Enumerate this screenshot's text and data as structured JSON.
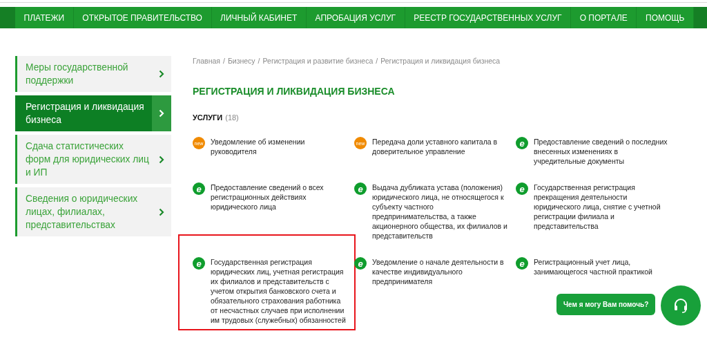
{
  "nav": [
    {
      "label": "ПЛАТЕЖИ"
    },
    {
      "label": "ОТКРЫТОЕ ПРАВИТЕЛЬСТВО"
    },
    {
      "label": "ЛИЧНЫЙ КАБИНЕТ"
    },
    {
      "label": "АПРОБАЦИЯ УСЛУГ"
    },
    {
      "label": "РЕЕСТР ГОСУДАРСТВЕННЫХ УСЛУГ"
    },
    {
      "label": "О ПОРТАЛЕ"
    },
    {
      "label": "ПОМОЩЬ"
    }
  ],
  "sidebar": {
    "items": [
      {
        "label": "Меры государственной поддержки",
        "selected": false
      },
      {
        "label": "Регистрация и ликвидация бизнеса",
        "selected": true
      },
      {
        "label": "Сдача статистических форм для юридических лиц и ИП",
        "selected": false
      },
      {
        "label": "Сведения о юридических лицах, филиалах, представительствах",
        "selected": false
      }
    ]
  },
  "breadcrumbs": [
    {
      "label": "Главная"
    },
    {
      "separator": "/",
      "label": "Бизнесу"
    },
    {
      "separator": "/",
      "label": "Регистрация и развитие бизнеса"
    },
    {
      "separator": "/",
      "label": "Регистрация и ликвидация бизнеса"
    }
  ],
  "title": "РЕГИСТРАЦИЯ И ЛИКВИДАЦИЯ БИЗНЕСА",
  "services": {
    "heading": "УСЛУГИ",
    "count": "(18)",
    "items": [
      {
        "kind": "new",
        "badge": "new",
        "text": "Уведомление об изменении руководителя",
        "highlighted": false
      },
      {
        "kind": "new",
        "badge": "new",
        "text": "Передача доли уставного капитала в доверительное управление",
        "highlighted": false
      },
      {
        "kind": "electronic",
        "badge": "e",
        "text": "Предоставление сведений о последних внесенных изменениях в учредительные документы",
        "highlighted": false
      },
      {
        "kind": "electronic",
        "badge": "e",
        "text": "Предоставление сведений о всех регистрационных действиях юридического лица",
        "highlighted": false
      },
      {
        "kind": "electronic",
        "badge": "e",
        "text": "Выдача дубликата устава (положения) юридического лица, не относящегося к субъекту частного предпринимательства, а также акционерного общества, их филиалов и представительств",
        "highlighted": false
      },
      {
        "kind": "electronic",
        "badge": "e",
        "text": "Государственная регистрация прекращения деятельности юридического лица, снятие с учетной регистрации филиала и представительства",
        "highlighted": false
      },
      {
        "kind": "electronic",
        "badge": "e",
        "text": "Государственная регистрация юридических лиц, учетная регистрация их филиалов и представительств с учетом открытия банковского счета и обязательного страхования работника от несчастных случаев при исполнении им трудовых (служебных) обязанностей",
        "highlighted": true
      },
      {
        "kind": "electronic",
        "badge": "e",
        "text": "Уведомление о начале деятельности в качестве индивидуального предпринимателя",
        "highlighted": false
      },
      {
        "kind": "electronic",
        "badge": "e",
        "text": "Регистрационный учет лица, занимающегося частной практикой",
        "highlighted": false
      }
    ]
  },
  "chat": {
    "prompt": "Чем я могу Вам помочь?"
  }
}
